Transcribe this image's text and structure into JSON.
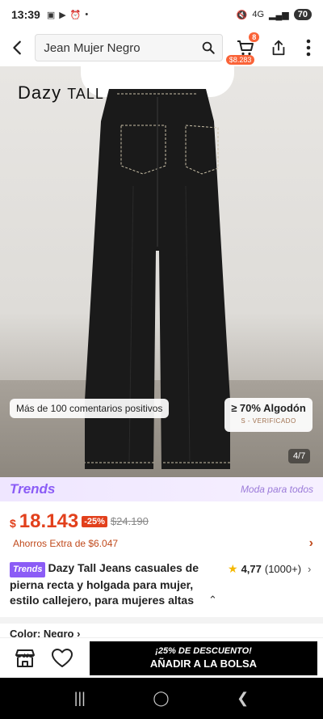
{
  "status": {
    "time": "13:39",
    "battery": "70",
    "network": "4G"
  },
  "search": {
    "query": "Jean Mujer Negro"
  },
  "cart": {
    "count": "8",
    "total": "$8.283"
  },
  "hero": {
    "brand_part1": "Dazy",
    "brand_part2": "TALL",
    "review_pill": "Más de 100 comentarios positivos",
    "cotton_label": "≥ 70% Algodón",
    "cotton_verified": "S - VERIFICADO",
    "page_indicator": "4/7"
  },
  "trends": {
    "logo": "Trends",
    "tagline": "Moda para todos"
  },
  "price": {
    "currency": "$",
    "current": "18.143",
    "discount": "-25%",
    "original": "$24.190",
    "savings": "Ahorros Extra de $6.047"
  },
  "product": {
    "badge": "Trends",
    "title": "Dazy Tall Jeans casuales de pierna recta y holgada para mujer, estilo callejero, para mujeres altas",
    "rating": "4,77",
    "reviews": "(1000+)"
  },
  "color_label": "Color: Negro",
  "bottom": {
    "promo": "¡25% DE DESCUENTO!",
    "add_label": "AÑADIR A LA BOLSA"
  },
  "colors": {
    "accent": "#e2401c",
    "trends": "#8b5cf6",
    "cart_badge": "#fa6338"
  }
}
